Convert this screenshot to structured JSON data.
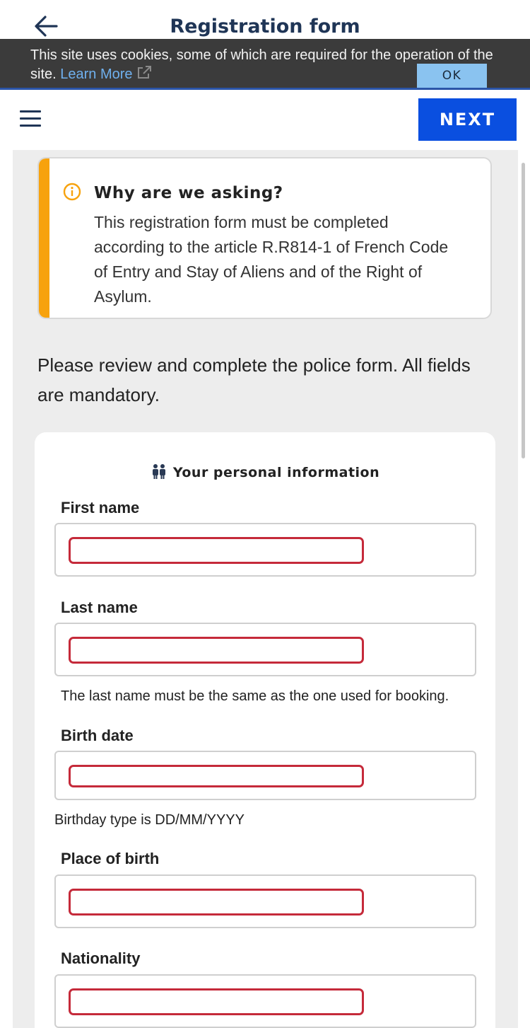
{
  "header": {
    "title": "Registration form",
    "back_icon": "arrow-left-icon"
  },
  "cookie_banner": {
    "text": "This site uses cookies, some of which are required for the operation of the site.",
    "link_label": "Learn More",
    "ok_label": "OK"
  },
  "nav": {
    "menu_icon": "hamburger-menu-icon",
    "next_label": "NEXT"
  },
  "info": {
    "title": "Why are we asking?",
    "body": "This registration form must be completed according to the article R.R814-1 of French Code of Entry and Stay of Aliens and of the Right of Asylum.",
    "accent_color": "#f7a20d"
  },
  "intro": "Please review and complete the police form. All fields are mandatory.",
  "form": {
    "section_title": "Your personal information",
    "fields": [
      {
        "label": "First name",
        "value": ""
      },
      {
        "label": "Last name",
        "value": "",
        "hint": "The last name must be the same as the one used for booking."
      },
      {
        "label": "Birth date",
        "value": "",
        "hint": "Birthday type is DD/MM/YYYY"
      },
      {
        "label": "Place of birth",
        "value": ""
      },
      {
        "label": "Nationality",
        "value": ""
      }
    ]
  },
  "colors": {
    "primary": "#0a4fe0",
    "error": "#c52a3a",
    "title": "#1f3556"
  }
}
